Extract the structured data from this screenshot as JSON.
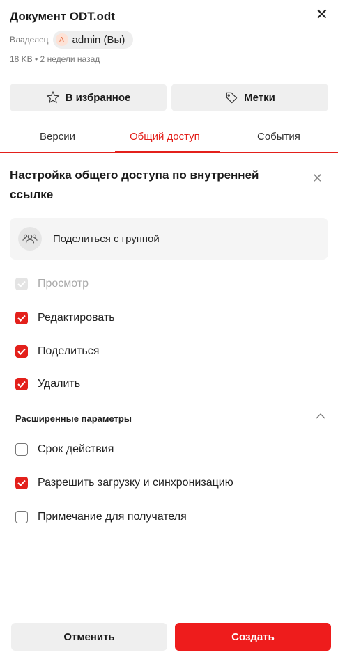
{
  "header": {
    "title": "Документ ODT.odt",
    "owner_label": "Владелец",
    "owner_avatar": "A",
    "owner_name": "admin (Вы)",
    "meta": "18 KB • 2 недели назад",
    "close_icon": "close-icon"
  },
  "actions": {
    "favorite_label": "В избранное",
    "tags_label": "Метки"
  },
  "tabs": [
    {
      "label": "Версии"
    },
    {
      "label": "Общий доступ"
    },
    {
      "label": "События"
    }
  ],
  "active_tab": "Общий доступ",
  "panel": {
    "title": "Настройка общего доступа по внутренней ссылке",
    "share_group_label": "Поделиться с группой"
  },
  "permissions": [
    {
      "label": "Просмотр",
      "checked": true,
      "disabled": true
    },
    {
      "label": "Редактировать",
      "checked": true
    },
    {
      "label": "Поделиться",
      "checked": true
    },
    {
      "label": "Удалить",
      "checked": true
    }
  ],
  "advanced": {
    "title": "Расширенные параметры",
    "expanded": true,
    "options": [
      {
        "label": "Срок действия",
        "checked": false
      },
      {
        "label": "Разрешить загрузку и синхронизацию",
        "checked": true
      },
      {
        "label": "Примечание для получателя",
        "checked": false
      }
    ]
  },
  "footer": {
    "cancel_label": "Отменить",
    "create_label": "Создать"
  },
  "colors": {
    "accent": "#e3201b",
    "create_button": "#ee1c1c",
    "secondary_button": "#efefef"
  }
}
